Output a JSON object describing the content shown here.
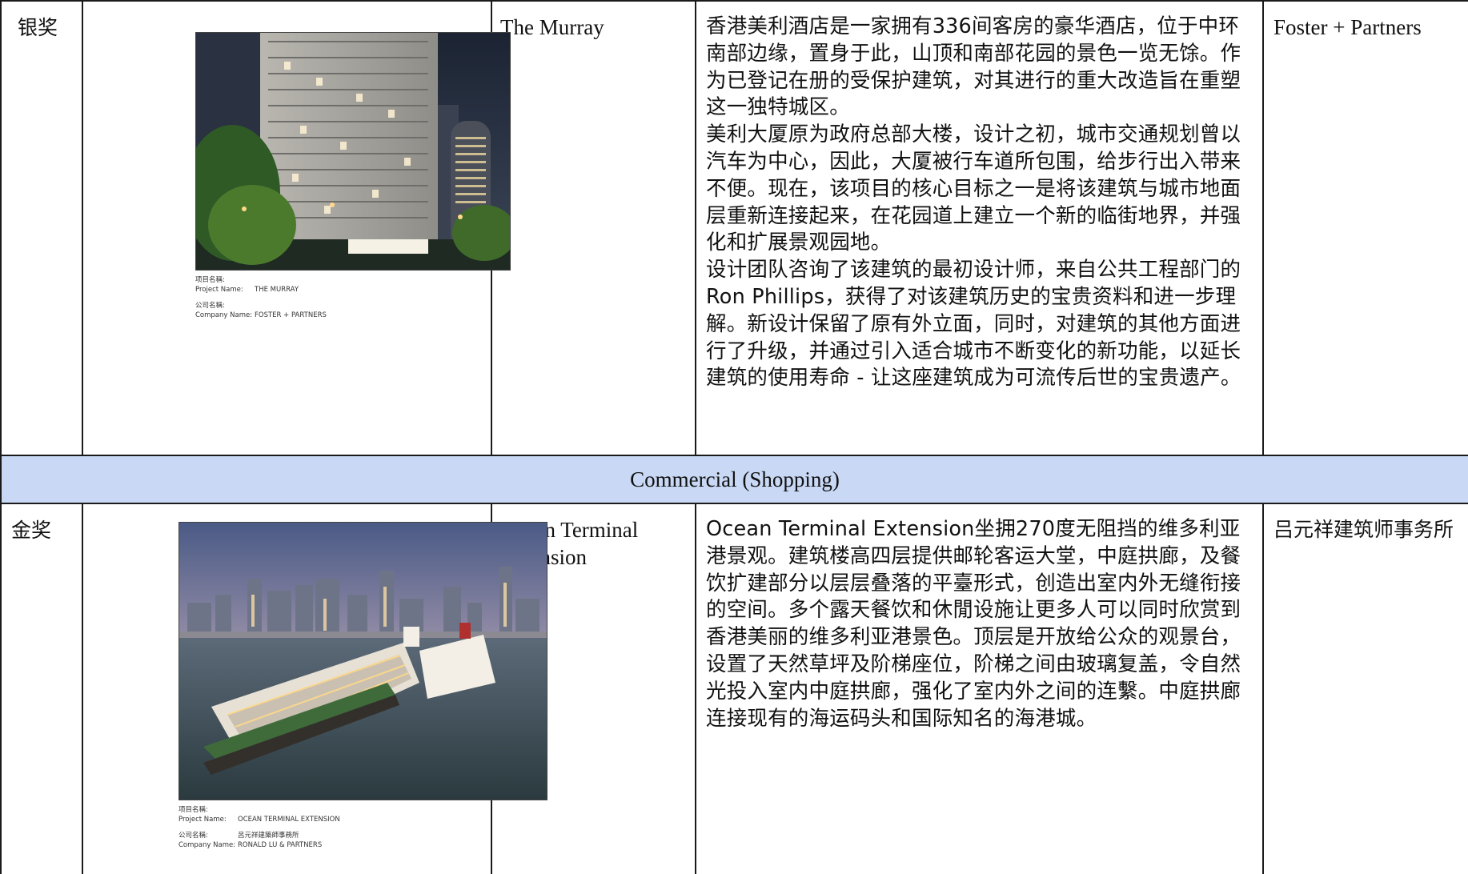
{
  "rows": [
    {
      "award": "银奖",
      "project_name": "The Murray",
      "description": [
        "香港美利酒店是一家拥有336间客房的豪华酒店，位于中环南部边缘，置身于此，山顶和南部花园的景色一览无馀。作为已登记在册的受保护建筑，对其进行的重大改造旨在重塑这一独特城区。",
        "美利大厦原为政府总部大楼，设计之初，城市交通规划曾以汽车为中心，因此，大厦被行车道所包围，给步行出入带来不便。现在，该项目的核心目标之一是将该建筑与城市地面层重新连接起来，在花园道上建立一个新的临街地界，并强化和扩展景观园地。",
        "设计团队咨询了该建筑的最初设计师，来自公共工程部门的Ron Phillips，获得了对该建筑历史的宝贵资料和进一步理解。新设计保留了原有外立面，同时，对建筑的其他方面进行了升级，并通过引入适合城市不断变化的新功能，以延长建筑的使用寿命 - 让这座建筑成为可流传后世的宝贵遗产。"
      ],
      "company": "Foster + Partners",
      "image_caption": {
        "project_label_cn": "项目名稱:",
        "project_label_en": "Project Name:",
        "project_value": "THE MURRAY",
        "company_label_cn": "公司名稱:",
        "company_label_en": "Company Name:",
        "company_value": "FOSTER + PARTNERS"
      }
    },
    {
      "award": "金奖",
      "project_name": "Ocean Terminal Extension",
      "description": [
        "Ocean Terminal Extension坐拥270度无阻挡的维多利亚港景观。建筑楼高四层提供邮轮客运大堂，中庭拱廊，及餐饮扩建部分以层层叠落的平臺形式，创造出室内外无缝衔接的空间。多个露天餐饮和休閒设施让更多人可以同时欣赏到香港美丽的维多利亚港景色。顶层是开放给公众的观景台，设置了天然草坪及阶梯座位，阶梯之间由玻璃复盖，令自然光投入室内中庭拱廊，强化了室内外之间的连繫。中庭拱廊连接现有的海运码头和国际知名的海港城。"
      ],
      "company": "吕元祥建筑师事务所",
      "image_caption": {
        "project_label_cn": "项目名稱:",
        "project_label_en": "Project Name:",
        "project_value": "OCEAN TERMINAL EXTENSION",
        "company_label_cn": "公司名稱:",
        "company_label_en": "Company Name:",
        "company_value_cn": "呂元祥建築師事務所",
        "company_value": "RONALD LU & PARTNERS"
      }
    }
  ],
  "section_header": "Commercial (Shopping)",
  "colors": {
    "section_background": "#c9d9f5",
    "border": "#1a1a1a"
  }
}
